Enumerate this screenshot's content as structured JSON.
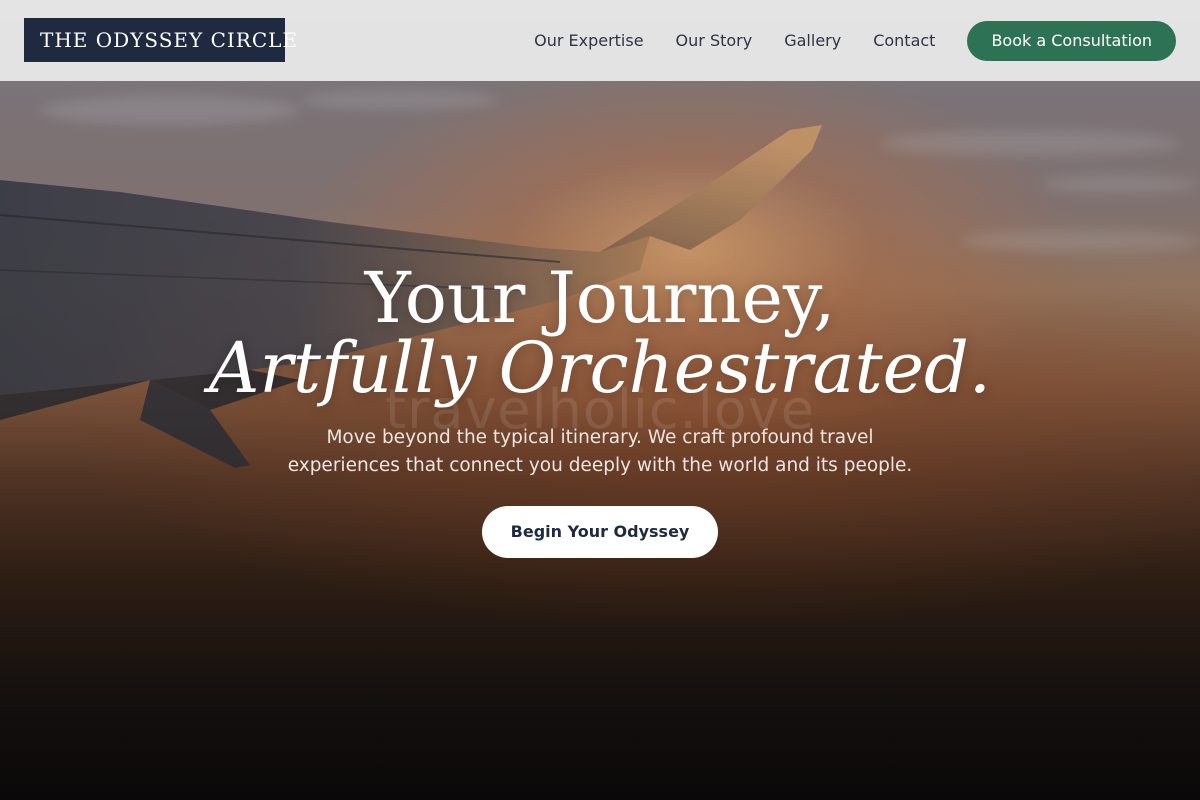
{
  "brand": {
    "name": "THE ODYSSEY CIRCLE"
  },
  "nav": {
    "items": [
      {
        "label": "Our Expertise"
      },
      {
        "label": "Our Story"
      },
      {
        "label": "Gallery"
      },
      {
        "label": "Contact"
      }
    ],
    "cta_label": "Book a Consultation"
  },
  "hero": {
    "headline_line1": "Your Journey,",
    "headline_line2": "Artfully Orchestrated.",
    "watermark": "travelholic.love",
    "subtext": "Move beyond the typical itinerary. We craft profound travel experiences that connect you deeply with the world and its people.",
    "button_label": "Begin Your Odyssey"
  },
  "colors": {
    "logo_bg": "#1f2a40",
    "cta_bg": "#2e7256",
    "header_bg": "#ececec"
  },
  "icons": {
    "hero_image": "airplane-wing-sunset-image"
  }
}
